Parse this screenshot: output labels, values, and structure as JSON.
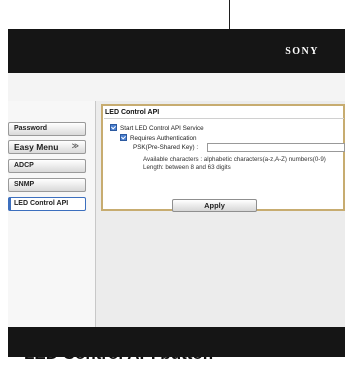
{
  "header": {
    "logo": "SONY"
  },
  "sidebar": {
    "items": [
      {
        "label": "Password",
        "active": false
      },
      {
        "label": "Easy Menu",
        "active": false,
        "chevron": "≫"
      },
      {
        "label": "ADCP",
        "active": false
      },
      {
        "label": "SNMP",
        "active": false
      },
      {
        "label": "LED Control API",
        "active": true
      }
    ]
  },
  "panel": {
    "title": "LED Control API",
    "start_service_label": "Start LED Control API Service",
    "start_service_checked": true,
    "requires_auth_label": "Requires Authentication",
    "requires_auth_checked": true,
    "psk_label": "PSK(Pre-Shared Key) :",
    "psk_value": "",
    "note_line1": "Available characters : alphabetic characters(a-z,A-Z) numbers(0-9)",
    "note_line2": "Length: between 8 and 63 digits"
  },
  "apply_label": "Apply",
  "callout": {
    "label": "LED Control API button"
  },
  "colors": {
    "accent": "#3c6fbe",
    "panel_border": "#c7ac70",
    "header_bg": "#151515"
  }
}
